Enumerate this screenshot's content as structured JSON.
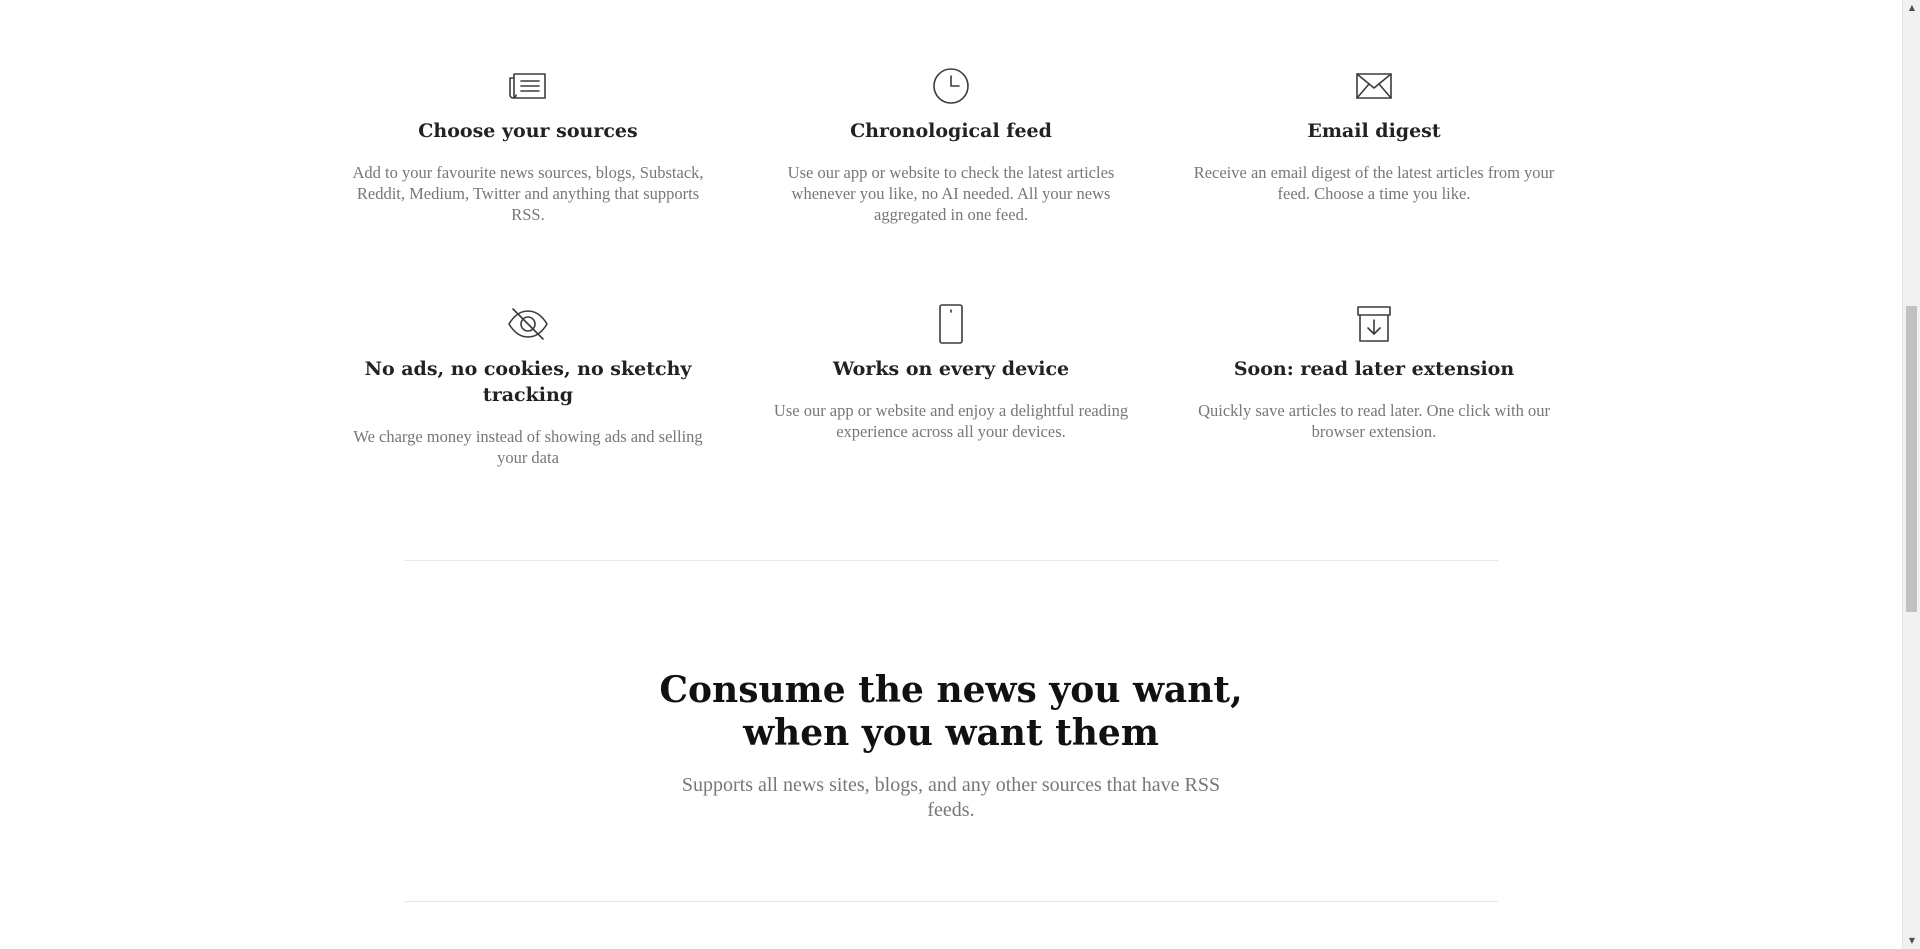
{
  "features": [
    {
      "icon": "newspaper-icon",
      "title": "Choose your sources",
      "desc": "Add to your favourite news sources, blogs, Substack, Reddit, Medium, Twitter and anything that supports RSS."
    },
    {
      "icon": "clock-icon",
      "title": "Chronological feed",
      "desc": "Use our app or website to check the latest articles whenever you like, no AI needed. All your news aggregated in one feed."
    },
    {
      "icon": "envelope-icon",
      "title": "Email digest",
      "desc": "Receive an email digest of the latest articles from your feed. Choose a time you like."
    },
    {
      "icon": "eye-slash-icon",
      "title": "No ads, no cookies, no sketchy tracking",
      "desc": "We charge money instead of showing ads and selling your data"
    },
    {
      "icon": "smartphone-icon",
      "title": "Works on every device",
      "desc": "Use our app or website and enjoy a delightful reading experience across all your devices."
    },
    {
      "icon": "archive-download-icon",
      "title": "Soon: read later extension",
      "desc": "Quickly save articles to read later. One click with our browser extension."
    }
  ],
  "hero": {
    "heading_line1": "Consume the news you want,",
    "heading_line2": "when you want them",
    "subtext": "Supports all news sites, blogs, and any other sources that have RSS feeds."
  },
  "scrollbar": {
    "up_arrow": "▲",
    "down_arrow": "▼"
  }
}
